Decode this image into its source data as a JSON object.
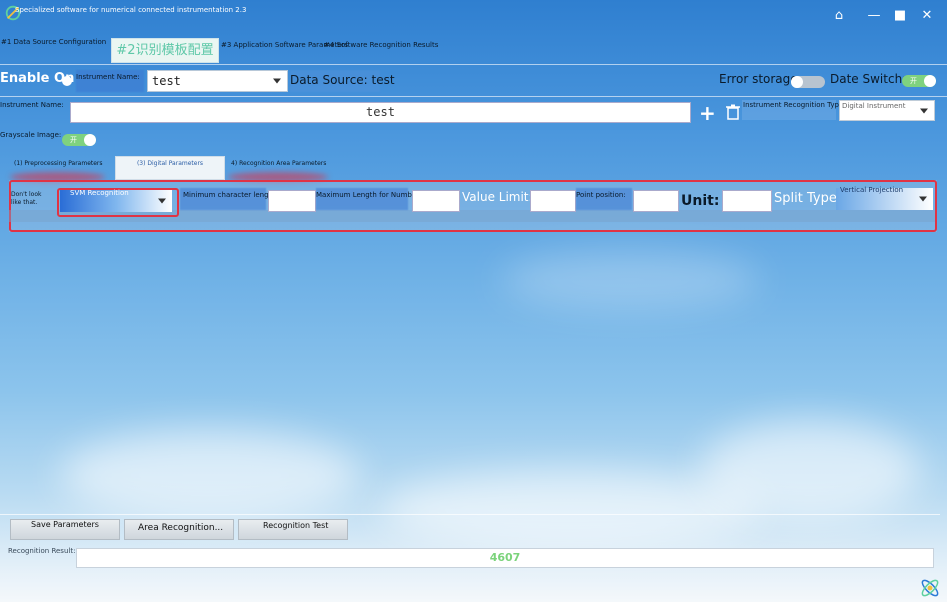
{
  "window": {
    "title": "Specialized software for numerical connected instrumentation 2.3",
    "buttons": {
      "skin": "⌂",
      "minimize": "—",
      "maximize": "■",
      "close": "✕"
    }
  },
  "tabs": [
    {
      "label": "#1 Data Source Configuration"
    },
    {
      "label": "#2识别模板配置"
    },
    {
      "label": "#3 Application Software Parameters"
    },
    {
      "label": "#4 Software Recognition Results"
    }
  ],
  "top_row": {
    "enable_label": "Enable On",
    "instrument_name_label": "Instrument Name:",
    "instrument_select_value": "test",
    "data_source": "Data Source: test",
    "error_storage_label": "Error storage:",
    "date_switch_label": "Date Switch:",
    "date_switch_text": "开"
  },
  "second_row": {
    "instrument_name_label": "Instrument Name:",
    "instrument_name_value": "test",
    "add_icon": "+",
    "recognition_type_label": "Instrument Recognition Type:",
    "recognition_type_value": "Digital Instrument"
  },
  "grayscale": {
    "label": "Grayscale Image:",
    "toggle_text": "开"
  },
  "subtabs": [
    {
      "label": "(1) Preprocessing Parameters"
    },
    {
      "label": "(3) Digital Parameters"
    },
    {
      "label": "4) Recognition Area Parameters"
    }
  ],
  "params": {
    "dont_look_label": "Don't look like that.",
    "svm_select": "SVM Recognition",
    "min_char_label": "Minimum character length",
    "max_len_label": "Maximum Length for Numbers",
    "value_limit_label": "Value Limit:",
    "point_position_label": "Point position:",
    "unit_label": "Unit:",
    "split_type_label": "Split Type:",
    "split_type_value": "Vertical Projection"
  },
  "bottom": {
    "save_button": "Save Parameters",
    "area_button": "Area Recognition...",
    "test_button": "Recognition Test",
    "result_label": "Recognition Result:",
    "result_value": "4607"
  },
  "colors": {
    "accent_green": "#5ec8a8",
    "result_green": "#7bd37b",
    "frame_red": "#e03345"
  }
}
